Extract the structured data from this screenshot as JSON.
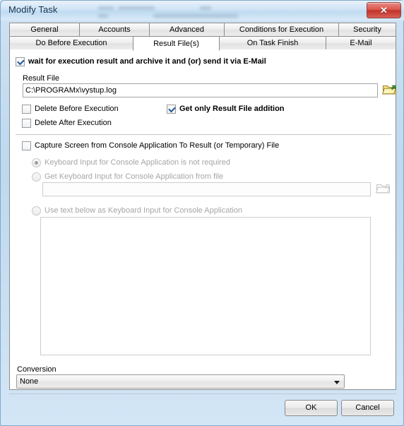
{
  "window": {
    "title": "Modify Task",
    "close_label": "✕"
  },
  "tabs": {
    "row1": [
      {
        "label": "General",
        "active": false
      },
      {
        "label": "Accounts",
        "active": false
      },
      {
        "label": "Advanced",
        "active": false
      },
      {
        "label": "Conditions for Execution",
        "active": false
      },
      {
        "label": "Security",
        "active": false
      }
    ],
    "row2": [
      {
        "label": "Do Before Execution",
        "active": false
      },
      {
        "label": "Result File(s)",
        "active": true
      },
      {
        "label": "On Task Finish",
        "active": false
      },
      {
        "label": "E-Mail",
        "active": false
      }
    ]
  },
  "main": {
    "wait_checkbox": {
      "label": "wait for execution result and archive it and (or) send it via E-Mail",
      "checked": true
    },
    "result_file": {
      "label": "Result File",
      "value": "C:\\PROGRAMx\\vystup.log",
      "placeholder": ""
    },
    "delete_before": {
      "label": "Delete Before Execution",
      "checked": false
    },
    "delete_after": {
      "label": "Delete After Execution",
      "checked": false
    },
    "get_only_addition": {
      "label": "Get only Result File addition",
      "checked": true
    },
    "capture_screen": {
      "label": "Capture Screen from Console Application To Result (or Temporary) File",
      "checked": false
    },
    "keyboard_options": [
      {
        "label": "Keyboard Input for Console Application is not required",
        "selected": true
      },
      {
        "label": "Get Keyboard Input for Console Application from file",
        "selected": false
      },
      {
        "label": "Use text below as Keyboard Input for Console Application",
        "selected": false
      }
    ],
    "keyboard_file": {
      "value": "",
      "placeholder": ""
    },
    "keyboard_text": {
      "value": "",
      "placeholder": ""
    },
    "conversion": {
      "label": "Conversion",
      "value": "None"
    }
  },
  "footer": {
    "ok_label": "OK",
    "cancel_label": "Cancel"
  },
  "icons": {
    "browse_result_file": "folder-open-icon",
    "browse_keyboard_file": "folder-open-icon",
    "scroll_up": "triangle-up-icon",
    "scroll_down": "triangle-down-icon",
    "dropdown": "chevron-down-icon"
  },
  "colors": {
    "frame": "#bed8ee",
    "panel": "#ffffff",
    "accent_check": "#21569e",
    "close_button": "#c23229",
    "disabled_text": "#a6a6a6"
  }
}
